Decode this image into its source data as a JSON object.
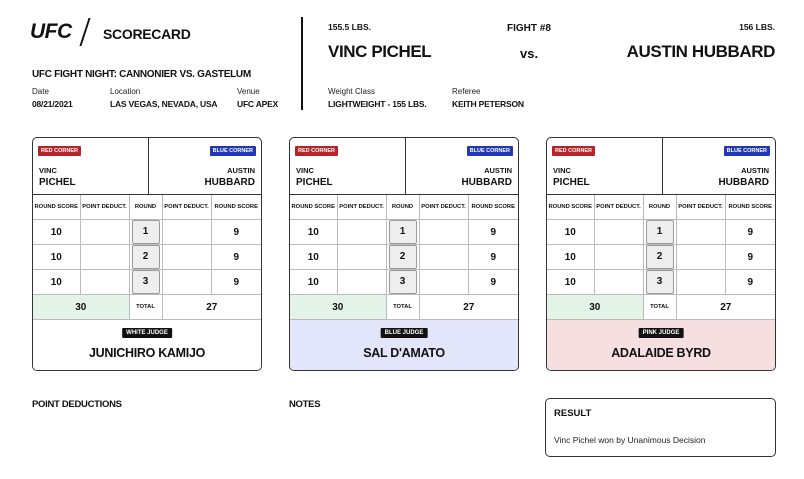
{
  "header": {
    "logo": "UFC",
    "title": "SCORECARD",
    "event": "UFC FIGHT NIGHT: CANNONIER VS. GASTELUM",
    "date_label": "Date",
    "date": "08/21/2021",
    "location_label": "Location",
    "location": "LAS VEGAS, NEVADA, USA",
    "venue_label": "Venue",
    "venue": "UFC APEX"
  },
  "fight": {
    "number": "FIGHT #8",
    "red_weight": "155.5 LBS.",
    "blue_weight": "156 LBS.",
    "red_fighter": "VINC PICHEL",
    "blue_fighter": "AUSTIN HUBBARD",
    "vs": "vs.",
    "weight_class_label": "Weight Class",
    "weight_class": "LIGHTWEIGHT - 155 LBS.",
    "referee_label": "Referee",
    "referee": "KEITH PETERSON"
  },
  "labels": {
    "red_corner": "RED CORNER",
    "blue_corner": "BLUE CORNER",
    "red_first": "VINC",
    "red_last": "PICHEL",
    "blue_first": "AUSTIN",
    "blue_last": "HUBBARD",
    "round_score": "ROUND SCORE",
    "point_deduct": "POINT DEDUCT.",
    "round": "ROUND",
    "total": "TOTAL"
  },
  "cards": [
    {
      "judge_label": "WHITE JUDGE",
      "judge": "JUNICHIRO KAMIJO",
      "color": "#ffffff",
      "rounds": [
        {
          "round": "1",
          "red": "10",
          "red_ded": "",
          "blue_ded": "",
          "blue": "9"
        },
        {
          "round": "2",
          "red": "10",
          "red_ded": "",
          "blue_ded": "",
          "blue": "9"
        },
        {
          "round": "3",
          "red": "10",
          "red_ded": "",
          "blue_ded": "",
          "blue": "9"
        }
      ],
      "red_total": "30",
      "blue_total": "27"
    },
    {
      "judge_label": "BLUE JUDGE",
      "judge": "SAL D'AMATO",
      "color": "#e3e6fb",
      "rounds": [
        {
          "round": "1",
          "red": "10",
          "red_ded": "",
          "blue_ded": "",
          "blue": "9"
        },
        {
          "round": "2",
          "red": "10",
          "red_ded": "",
          "blue_ded": "",
          "blue": "9"
        },
        {
          "round": "3",
          "red": "10",
          "red_ded": "",
          "blue_ded": "",
          "blue": "9"
        }
      ],
      "red_total": "30",
      "blue_total": "27"
    },
    {
      "judge_label": "PINK JUDGE",
      "judge": "ADALAIDE BYRD",
      "color": "#f6dfe0",
      "rounds": [
        {
          "round": "1",
          "red": "10",
          "red_ded": "",
          "blue_ded": "",
          "blue": "9"
        },
        {
          "round": "2",
          "red": "10",
          "red_ded": "",
          "blue_ded": "",
          "blue": "9"
        },
        {
          "round": "3",
          "red": "10",
          "red_ded": "",
          "blue_ded": "",
          "blue": "9"
        }
      ],
      "red_total": "30",
      "blue_total": "27"
    }
  ],
  "footer": {
    "point_deductions": "POINT DEDUCTIONS",
    "notes": "NOTES",
    "result_title": "RESULT",
    "result_text": "Vinc Pichel won by Unanimous Decision"
  }
}
